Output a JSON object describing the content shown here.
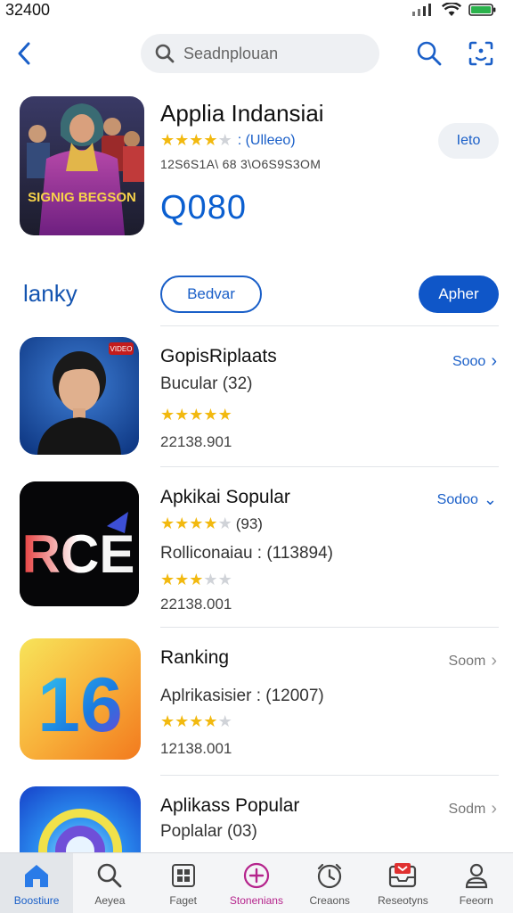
{
  "status": {
    "time": "32400"
  },
  "search": {
    "placeholder": "Seadnplouan"
  },
  "featured": {
    "title": "Applia Indansiai",
    "rating_stars": 3.5,
    "rating_text": ": (Ulleeo)",
    "meta": "12S6S1A\\ 68  3\\O6S9S3OM",
    "price": "Q080",
    "button_label": "Ieto",
    "poster_text": "SIGNIG BEGSON"
  },
  "segment": {
    "label": "lanky",
    "outline_button": "Bedvar",
    "fill_button": "Apher"
  },
  "apps": [
    {
      "title": "GopisRiplaats",
      "subtitle": "Bucular (32)",
      "stars": 4.5,
      "stars_label": "",
      "second_stars": null,
      "count": "22138.901",
      "see_label": "Sooo",
      "see_chevron": "›",
      "badge": "VIDEO"
    },
    {
      "title": "Apkikai Sopular",
      "stars": 4,
      "stars_label": "(93)",
      "subtitle": "Rolliconaiau : (113894)",
      "second_stars": 3,
      "count": "22138.001",
      "see_label": "Sodoo",
      "see_chevron": "⌄",
      "icon_text": "RCE"
    },
    {
      "title": "Ranking",
      "subtitle": "Aplrikasisier : (12007)",
      "stars": 3.5,
      "stars_label": "",
      "count": "12138.001",
      "see_label": "Soom",
      "see_chevron": "›",
      "icon_text": "16"
    },
    {
      "title": "Aplikass Popular",
      "subtitle": "Poplalar (03)",
      "see_label": "Sodm",
      "see_chevron": "›"
    }
  ],
  "tabs": [
    {
      "label": "Boostiure",
      "icon": "home-icon",
      "active": true
    },
    {
      "label": "Aeyea",
      "icon": "search-icon"
    },
    {
      "label": "Faget",
      "icon": "grid-icon"
    },
    {
      "label": "Stonenians",
      "icon": "plus-circle-icon"
    },
    {
      "label": "Creaons",
      "icon": "clock-icon"
    },
    {
      "label": "Reseotyns",
      "icon": "inbox-icon"
    },
    {
      "label": "Feeorn",
      "icon": "person-icon"
    }
  ],
  "colors": {
    "accent": "#1a5fc8",
    "star": "#f2b90f",
    "price": "#0b5fd0"
  }
}
